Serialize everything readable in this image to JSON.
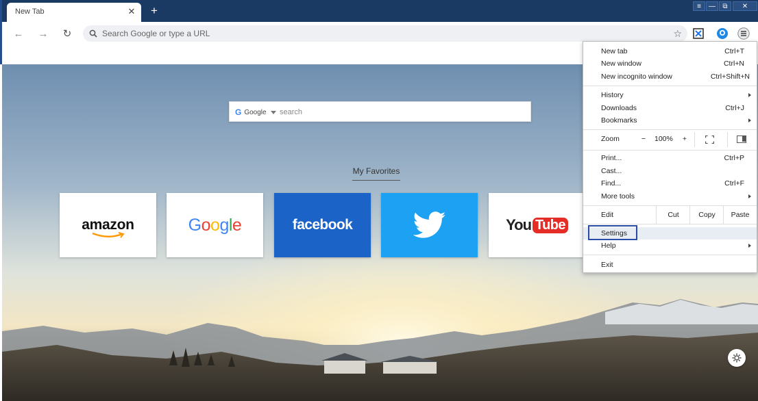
{
  "tab": {
    "title": "New Tab",
    "close": "✕"
  },
  "newtab": {
    "label": "+"
  },
  "window_controls": [
    "≡",
    "—",
    "⧉",
    "✕"
  ],
  "toolbar": {
    "back": "←",
    "forward": "→",
    "reload": "↻",
    "omnibox_placeholder": "Search Google or type a URL",
    "star": "☆"
  },
  "ntp": {
    "search_engine": "Google",
    "search_placeholder": "search",
    "favorites_title": "My Favorites",
    "tiles": {
      "amazon": "amazon",
      "google": [
        "G",
        "o",
        "o",
        "g",
        "l",
        "e"
      ],
      "google_colors": [
        "#4285f4",
        "#ea4335",
        "#fbbc05",
        "#4285f4",
        "#34a853",
        "#ea4335"
      ],
      "facebook": "facebook",
      "youtube_you": "You",
      "youtube_tube": "Tube"
    }
  },
  "menu": {
    "new_tab": {
      "label": "New tab",
      "shortcut": "Ctrl+T"
    },
    "new_window": {
      "label": "New window",
      "shortcut": "Ctrl+N"
    },
    "new_incognito": {
      "label": "New incognito window",
      "shortcut": "Ctrl+Shift+N"
    },
    "history": {
      "label": "History"
    },
    "downloads": {
      "label": "Downloads",
      "shortcut": "Ctrl+J"
    },
    "bookmarks": {
      "label": "Bookmarks"
    },
    "zoom": {
      "label": "Zoom",
      "minus": "−",
      "value": "100%",
      "plus": "+"
    },
    "print": {
      "label": "Print...",
      "shortcut": "Ctrl+P"
    },
    "cast": {
      "label": "Cast..."
    },
    "find": {
      "label": "Find...",
      "shortcut": "Ctrl+F"
    },
    "more_tools": {
      "label": "More tools"
    },
    "edit": {
      "label": "Edit",
      "cut": "Cut",
      "copy": "Copy",
      "paste": "Paste"
    },
    "settings": {
      "label": "Settings"
    },
    "help": {
      "label": "Help"
    },
    "exit": {
      "label": "Exit"
    }
  },
  "colors": {
    "tabstrip": "#1b3a63",
    "accent": "#2a4ea8",
    "facebook": "#1b63c6",
    "twitter": "#1da1f2",
    "youtube": "#e52d27"
  }
}
